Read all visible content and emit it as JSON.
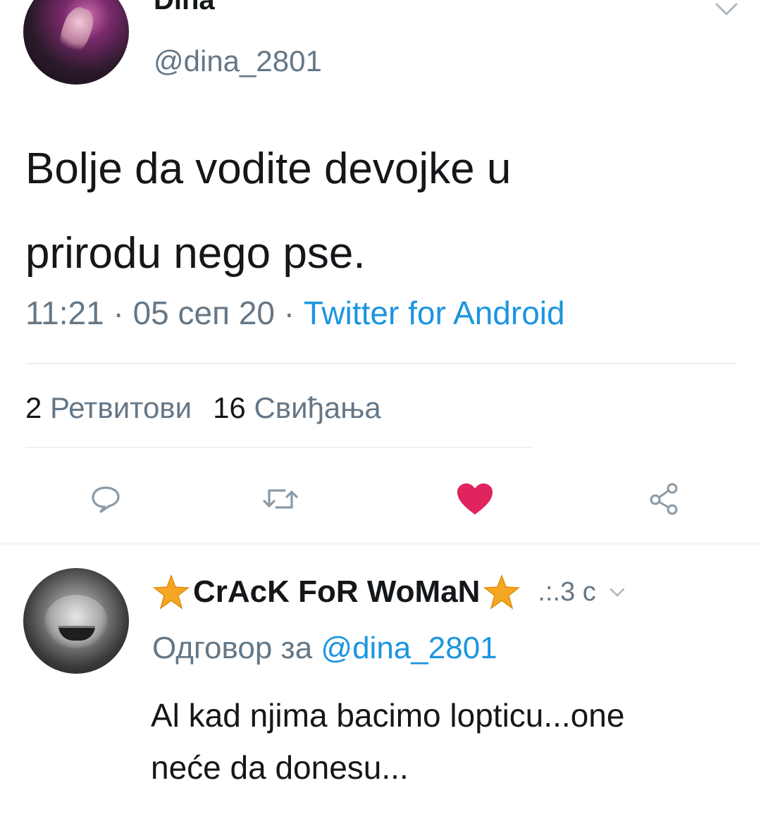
{
  "tweet": {
    "author_name": "Dina",
    "author_handle": "@dina_2801",
    "text_lines": [
      "Bolje da vodite devojke u",
      "prirodu nego pse."
    ],
    "time": "11:21",
    "date": "05 сеп 20",
    "separator": "·",
    "source": "Twitter for Android",
    "retweet_count": "2",
    "retweet_label": "Ретвитови",
    "like_count": "16",
    "like_label": "Свиђања",
    "liked": true
  },
  "actions": [
    {
      "name": "reply",
      "icon": "comment-icon"
    },
    {
      "name": "retweet",
      "icon": "retweet-icon"
    },
    {
      "name": "like",
      "icon": "heart-icon"
    },
    {
      "name": "share",
      "icon": "share-icon"
    }
  ],
  "reply": {
    "author_name": "CrAcK FoR WoMaN",
    "time": ".:.3 с",
    "reply_to_label": "Одговор за",
    "reply_to_handle": "@dina_2801",
    "text_lines": [
      "Al kad njima bacimo lopticu...one",
      "neće da donesu..."
    ]
  },
  "colors": {
    "text": "#14171a",
    "secondary": "#657786",
    "link": "#1b95e0",
    "like": "#e0245e",
    "star": "#f5a623"
  }
}
